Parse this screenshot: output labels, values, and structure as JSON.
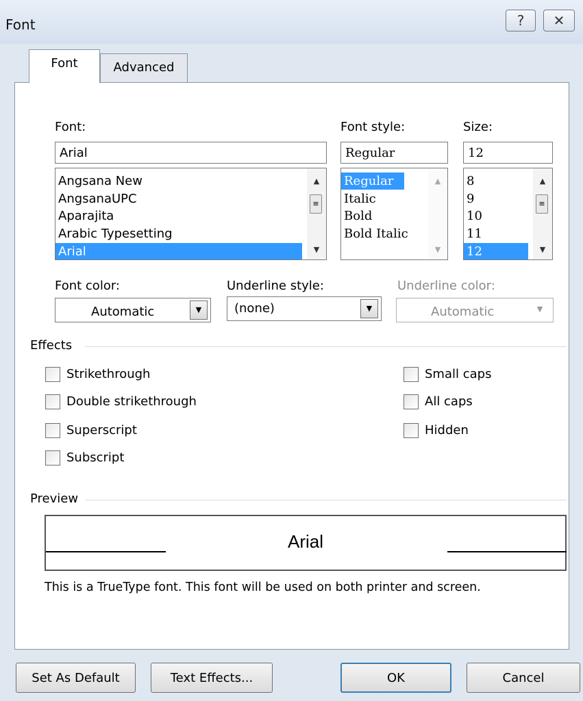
{
  "window": {
    "title": "Font",
    "help_glyph": "?",
    "close_glyph": "✕"
  },
  "tabs": [
    {
      "label": "Font",
      "active": true
    },
    {
      "label": "Advanced",
      "active": false
    }
  ],
  "font": {
    "label": "Font:",
    "value": "Arial",
    "list": [
      "Angsana New",
      "AngsanaUPC",
      "Aparajita",
      "Arabic Typesetting",
      "Arial"
    ],
    "selected": "Arial"
  },
  "font_style": {
    "label": "Font style:",
    "value": "Regular",
    "list": [
      "Regular",
      "Italic",
      "Bold",
      "Bold Italic"
    ],
    "selected": "Regular"
  },
  "size": {
    "label": "Size:",
    "value": "12",
    "list": [
      "8",
      "9",
      "10",
      "11",
      "12"
    ],
    "selected": "12"
  },
  "font_color": {
    "label": "Font color:",
    "value": "Automatic"
  },
  "underline_style": {
    "label": "Underline style:",
    "value": "(none)"
  },
  "underline_color": {
    "label": "Underline color:",
    "value": "Automatic",
    "disabled": true
  },
  "effects": {
    "heading": "Effects",
    "left": [
      {
        "label": "Strikethrough",
        "checked": false
      },
      {
        "label": "Double strikethrough",
        "checked": false
      },
      {
        "label": "Superscript",
        "checked": false
      },
      {
        "label": "Subscript",
        "checked": false
      }
    ],
    "right": [
      {
        "label": "Small caps",
        "checked": false
      },
      {
        "label": "All caps",
        "checked": false
      },
      {
        "label": "Hidden",
        "checked": false
      }
    ]
  },
  "preview": {
    "heading": "Preview",
    "sample": "Arial",
    "note": "This is a TrueType font. This font will be used on both printer and screen."
  },
  "buttons": {
    "set_default": "Set As Default",
    "text_effects": "Text Effects...",
    "ok": "OK",
    "cancel": "Cancel"
  },
  "colors": {
    "selection": "#3399ff",
    "default_button_border": "#3c7fb1"
  }
}
